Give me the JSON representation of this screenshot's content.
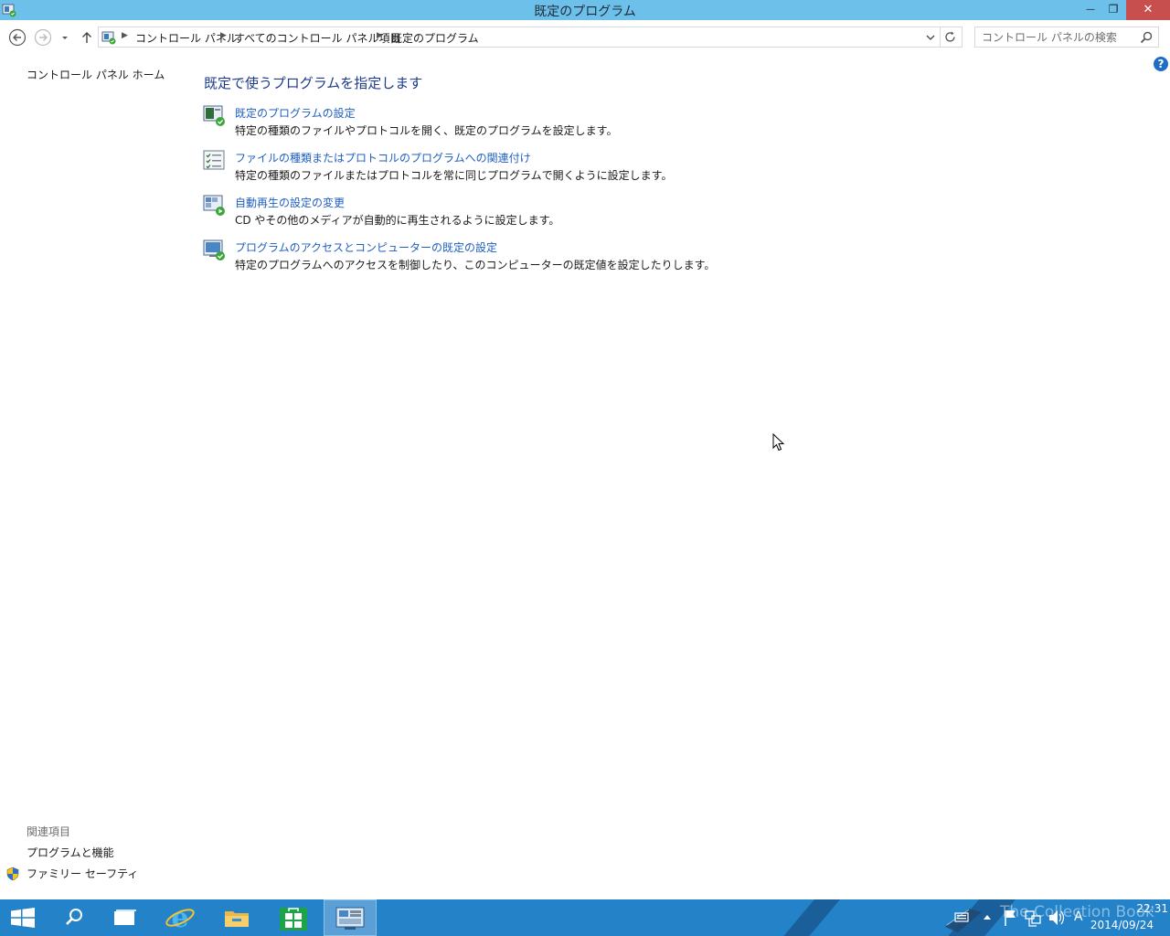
{
  "window": {
    "title": "既定のプログラム",
    "minimize_glyph": "—",
    "restore_glyph": "❐",
    "close_glyph": "✕"
  },
  "address": {
    "breadcrumbs": [
      "コントロール パネル",
      "すべてのコントロール パネル項目",
      "既定のプログラム"
    ],
    "search_placeholder": "コントロール パネルの検索"
  },
  "left_pane": {
    "home_link": "コントロール パネル ホーム",
    "related_heading": "関連項目",
    "related_links": [
      "プログラムと機能",
      "ファミリー セーフティ"
    ]
  },
  "main": {
    "heading": "既定で使うプログラムを指定します",
    "tasks": [
      {
        "link": "既定のプログラムの設定",
        "description": "特定の種類のファイルやプロトコルを開く、既定のプログラムを設定します。",
        "icon": "default-programs-icon"
      },
      {
        "link": "ファイルの種類またはプロトコルのプログラムへの関連付け",
        "description": "特定の種類のファイルまたはプロトコルを常に同じプログラムで開くように設定します。",
        "icon": "file-association-icon"
      },
      {
        "link": "自動再生の設定の変更",
        "description": "CD やその他のメディアが自動的に再生されるように設定します。",
        "icon": "autoplay-icon"
      },
      {
        "link": "プログラムのアクセスとコンピューターの既定の設定",
        "description": "特定のプログラムへのアクセスを制御したり、このコンピューターの既定値を設定したりします。",
        "icon": "program-access-icon"
      }
    ]
  },
  "help": {
    "glyph": "?"
  },
  "taskbar": {
    "items": [
      "start-button",
      "search-button",
      "task-view-button",
      "internet-explorer",
      "file-explorer",
      "store",
      "control-panel"
    ],
    "ime": "A",
    "time": "22:31",
    "date": "2014/09/24",
    "watermark": "The Collection Book"
  },
  "colors": {
    "titlebar": "#6cc0ea",
    "taskbar": "#2382c8",
    "link": "#1f5fbf",
    "heading": "#1e3a8a",
    "close": "#c7504f"
  }
}
